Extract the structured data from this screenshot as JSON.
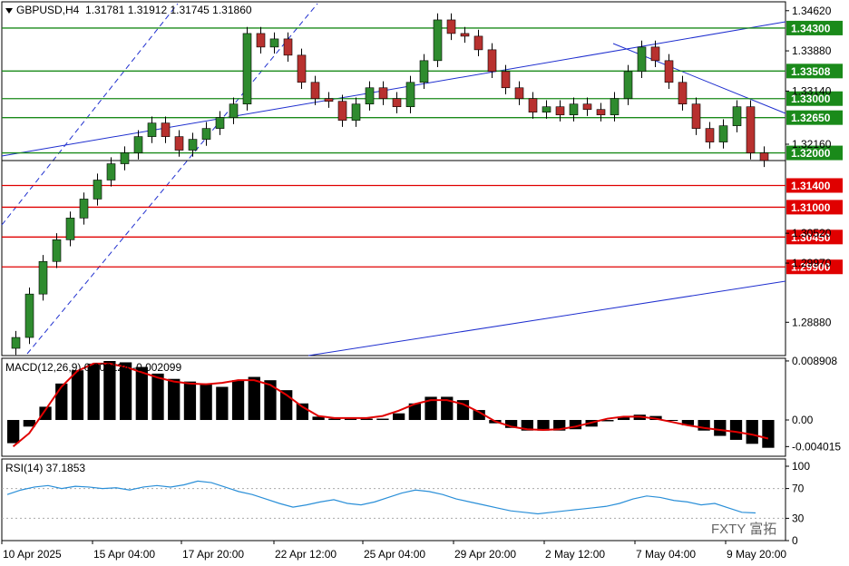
{
  "header": {
    "symbol": "GBPUSD,H4",
    "ohlc": "1.31781 1.31912 1.31745 1.31860"
  },
  "price_axis": {
    "ticks": [
      "1.34620",
      "1.33880",
      "1.33140",
      "1.32160",
      "1.30520",
      "1.29970",
      "1.28880"
    ]
  },
  "levels": [
    {
      "label": "1.34300",
      "value": 1.343,
      "kind": "resistance"
    },
    {
      "label": "1.33508",
      "value": 1.33508,
      "kind": "resistance"
    },
    {
      "label": "1.33000",
      "value": 1.33,
      "kind": "resistance"
    },
    {
      "label": "1.32650",
      "value": 1.3265,
      "kind": "resistance"
    },
    {
      "label": "1.32000",
      "value": 1.32,
      "kind": "resistance"
    },
    {
      "label": "1.31400",
      "value": 1.314,
      "kind": "support"
    },
    {
      "label": "1.31000",
      "value": 1.31,
      "kind": "support"
    },
    {
      "label": "1.30450",
      "value": 1.3045,
      "kind": "support"
    },
    {
      "label": "1.29900",
      "value": 1.299,
      "kind": "support"
    }
  ],
  "current_price": "1.31860",
  "macd": {
    "label": "MACD(12,26,9) 0.000124 -0.002099",
    "ticks": [
      "0.008908",
      "0.00",
      "-0.004015"
    ]
  },
  "rsi": {
    "label": "RSI(14) 37.1853",
    "ticks": [
      "100",
      "70",
      "30",
      "0"
    ]
  },
  "time_axis": [
    "10 Apr 2025",
    "15 Apr 04:00",
    "17 Apr 20:00",
    "22 Apr 12:00",
    "25 Apr 04:00",
    "29 Apr 20:00",
    "2 May 12:00",
    "7 May 04:00",
    "9 May 20:00"
  ],
  "watermark": "FXTY 富拓",
  "colors": {
    "bull": "#2e8b2e",
    "bear": "#b8312f",
    "resistance": "#1a8a1a",
    "support": "#e00000",
    "trend": "#1f2fcf",
    "macd_signal": "#e00000",
    "rsi_line": "#2a8fd8"
  },
  "chart_data": {
    "type": "candlestick",
    "title": "GBPUSD,H4",
    "ylim": [
      1.283,
      1.3475
    ],
    "x_labels": [
      "10 Apr 2025",
      "15 Apr 04:00",
      "17 Apr 20:00",
      "22 Apr 12:00",
      "25 Apr 04:00",
      "29 Apr 20:00",
      "2 May 12:00",
      "7 May 04:00",
      "9 May 20:00"
    ],
    "series": [
      {
        "name": "close",
        "values": [
          1.286,
          1.294,
          1.3,
          1.304,
          1.308,
          1.3115,
          1.315,
          1.318,
          1.32,
          1.323,
          1.3255,
          1.323,
          1.3205,
          1.3225,
          1.3245,
          1.3265,
          1.329,
          1.342,
          1.3395,
          1.341,
          1.338,
          1.333,
          1.33,
          1.3295,
          1.326,
          1.329,
          1.332,
          1.33,
          1.3285,
          1.333,
          1.337,
          1.3445,
          1.342,
          1.3415,
          1.339,
          1.335,
          1.332,
          1.33,
          1.3275,
          1.3285,
          1.327,
          1.329,
          1.328,
          1.327,
          1.33,
          1.335,
          1.3395,
          1.337,
          1.333,
          1.329,
          1.3245,
          1.322,
          1.325,
          1.3285,
          1.32,
          1.3186
        ]
      },
      {
        "name": "MACD histogram",
        "values": [
          -0.0035,
          -0.001,
          0.002,
          0.0055,
          0.0075,
          0.0085,
          0.0089,
          0.0087,
          0.008,
          0.007,
          0.0062,
          0.0058,
          0.0055,
          0.005,
          0.006,
          0.0065,
          0.006,
          0.0045,
          0.0025,
          0.0005,
          0.0002,
          0.0002,
          0.0002,
          0.0002,
          0.001,
          0.0025,
          0.0035,
          0.0035,
          0.003,
          0.0015,
          -0.0005,
          -0.0012,
          -0.0016,
          -0.0016,
          -0.0016,
          -0.0014,
          -0.001,
          -0.0002,
          0.0005,
          0.0008,
          0.0006,
          0.0,
          -0.0008,
          -0.0016,
          -0.0024,
          -0.003,
          -0.0036,
          -0.0042
        ]
      },
      {
        "name": "MACD signal",
        "values": [
          -0.004,
          -0.002,
          0.0015,
          0.005,
          0.0074,
          0.0085,
          0.0085,
          0.008,
          0.0072,
          0.0064,
          0.0058,
          0.0055,
          0.0054,
          0.0056,
          0.006,
          0.006,
          0.0053,
          0.0038,
          0.002,
          0.0006,
          0.0003,
          0.0003,
          0.0003,
          0.0006,
          0.0014,
          0.0024,
          0.003,
          0.003,
          0.0024,
          0.0012,
          -0.0002,
          -0.001,
          -0.0014,
          -0.0015,
          -0.0014,
          -0.001,
          -0.0004,
          0.0002,
          0.0005,
          0.0005,
          0.0002,
          -0.0003,
          -0.0008,
          -0.0012,
          -0.0015,
          -0.0018,
          -0.0022,
          -0.0028
        ]
      },
      {
        "name": "RSI(14)",
        "values": [
          62,
          68,
          72,
          74,
          70,
          73,
          72,
          70,
          71,
          68,
          72,
          74,
          72,
          75,
          80,
          78,
          72,
          66,
          62,
          56,
          50,
          45,
          48,
          52,
          55,
          50,
          48,
          52,
          58,
          64,
          68,
          66,
          62,
          56,
          52,
          48,
          44,
          40,
          38,
          36,
          38,
          40,
          42,
          44,
          46,
          50,
          56,
          60,
          58,
          54,
          52,
          48,
          50,
          44,
          38,
          37.1853
        ]
      }
    ]
  }
}
